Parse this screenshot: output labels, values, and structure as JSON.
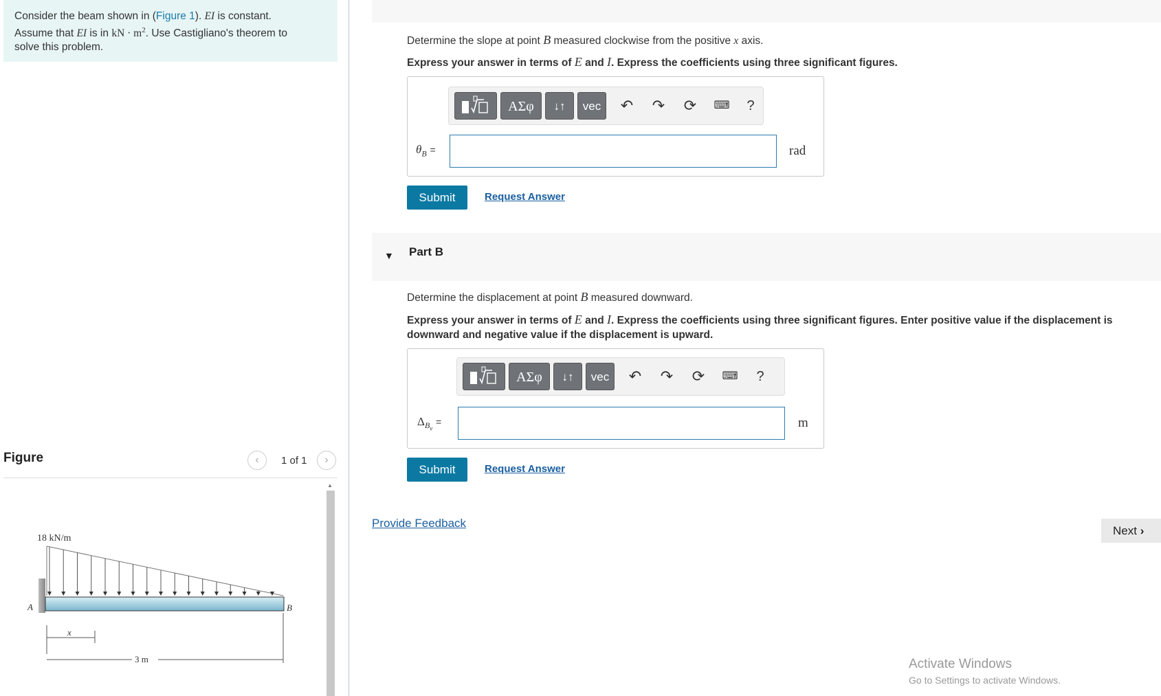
{
  "problem": {
    "t1": "Consider the beam shown in (",
    "figure_link": "Figure 1",
    "t2": ").",
    "ei": "EI",
    "t3": "is constant.",
    "t4": "Assume that",
    "t5": "is in",
    "units": "kN · m",
    "sup": "2",
    "t6": ". Use Castigliano's theorem to",
    "t7": "solve this problem."
  },
  "figure": {
    "title": "Figure",
    "pager": "1 of 1",
    "prev_icon": "chevron-left-icon",
    "next_icon": "chevron-right-icon",
    "load_label": "18 kN/m",
    "point_a": "A",
    "point_b": "B",
    "x_label": "x",
    "length_label": "3 m"
  },
  "part_a": {
    "q1": "Determine the slope at point",
    "q_b": "B",
    "q2": "measured clockwise from the positive",
    "q_x": "x",
    "q3": "axis.",
    "i1": "Express your answer in terms of",
    "i_e": "E",
    "i2": "and",
    "i_i": "I",
    "i3": ". Express the coefficients using three significant figures.",
    "label_sym": "θ",
    "label_sub": "B",
    "label_eq": "=",
    "input_value": "",
    "unit": "rad",
    "submit": "Submit",
    "request": "Request Answer"
  },
  "part_b": {
    "caret": "▼",
    "title": "Part B",
    "q1": "Determine the displacement at point",
    "q_b": "B",
    "q2": "measured downward.",
    "i1": "Express your answer in terms of",
    "i_e": "E",
    "i2": "and",
    "i_i": "I",
    "i3": ". Express the coefficients using three significant figures. Enter positive value if the displacement is",
    "i4": "downward and negative value if the displacement is upward.",
    "label_sym": "Δ",
    "label_sub": "B",
    "label_subsub": "v",
    "label_eq": "=",
    "input_value": "",
    "unit": "m",
    "submit": "Submit",
    "request": "Request Answer"
  },
  "toolbar": {
    "greek": "ΑΣφ",
    "arrows": "↓↑",
    "vec": "vec",
    "help": "?",
    "undo_icon": "undo-icon",
    "redo_icon": "redo-icon",
    "reset_icon": "reset-icon",
    "keyboard_icon": "keyboard-icon"
  },
  "feedback": "Provide Feedback",
  "next": "Next",
  "watermark": {
    "line1": "Activate Windows",
    "line2": "Go to Settings to activate Windows."
  }
}
